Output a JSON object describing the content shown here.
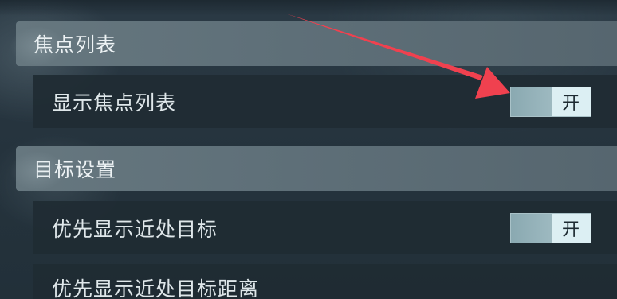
{
  "sections": {
    "focus_list": {
      "title": "焦点列表",
      "rows": [
        {
          "label": "显示焦点列表",
          "toggle_state": "开",
          "enabled": true
        }
      ]
    },
    "target_settings": {
      "title": "目标设置",
      "rows": [
        {
          "label": "优先显示近处目标",
          "toggle_state": "开",
          "enabled": true
        },
        {
          "label": "优先显示近处目标距离"
        }
      ]
    }
  },
  "colors": {
    "annotation_arrow": "#f0414f",
    "toggle_knob": "#8aa9b1",
    "toggle_track": "#dceff3"
  }
}
